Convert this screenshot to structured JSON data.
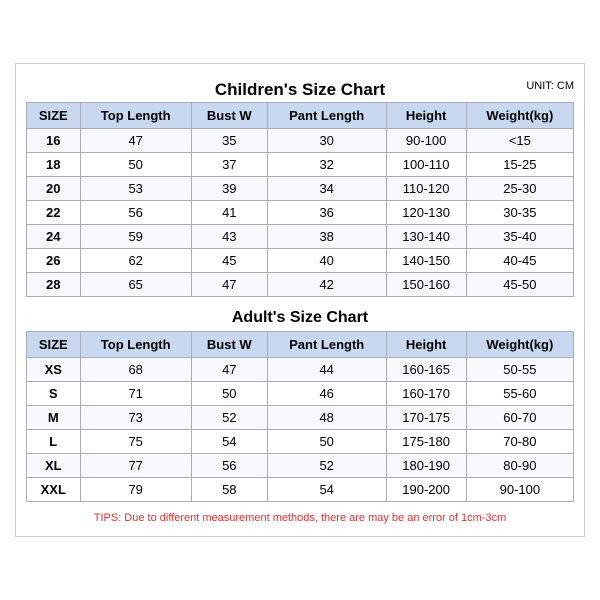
{
  "page": {
    "main_title": "Children's Size Chart",
    "unit": "UNIT: CM",
    "children_headers": [
      "SIZE",
      "Top Length",
      "Bust W",
      "Pant Length",
      "Height",
      "Weight(kg)"
    ],
    "children_rows": [
      [
        "16",
        "47",
        "35",
        "30",
        "90-100",
        "<15"
      ],
      [
        "18",
        "50",
        "37",
        "32",
        "100-110",
        "15-25"
      ],
      [
        "20",
        "53",
        "39",
        "34",
        "110-120",
        "25-30"
      ],
      [
        "22",
        "56",
        "41",
        "36",
        "120-130",
        "30-35"
      ],
      [
        "24",
        "59",
        "43",
        "38",
        "130-140",
        "35-40"
      ],
      [
        "26",
        "62",
        "45",
        "40",
        "140-150",
        "40-45"
      ],
      [
        "28",
        "65",
        "47",
        "42",
        "150-160",
        "45-50"
      ]
    ],
    "adult_title": "Adult's Size Chart",
    "adult_headers": [
      "SIZE",
      "Top Length",
      "Bust W",
      "Pant Length",
      "Height",
      "Weight(kg)"
    ],
    "adult_rows": [
      [
        "XS",
        "68",
        "47",
        "44",
        "160-165",
        "50-55"
      ],
      [
        "S",
        "71",
        "50",
        "46",
        "160-170",
        "55-60"
      ],
      [
        "M",
        "73",
        "52",
        "48",
        "170-175",
        "60-70"
      ],
      [
        "L",
        "75",
        "54",
        "50",
        "175-180",
        "70-80"
      ],
      [
        "XL",
        "77",
        "56",
        "52",
        "180-190",
        "80-90"
      ],
      [
        "XXL",
        "79",
        "58",
        "54",
        "190-200",
        "90-100"
      ]
    ],
    "tips": "TIPS: Due to different measurement methods, there are may be an error of 1cm-3cm"
  }
}
